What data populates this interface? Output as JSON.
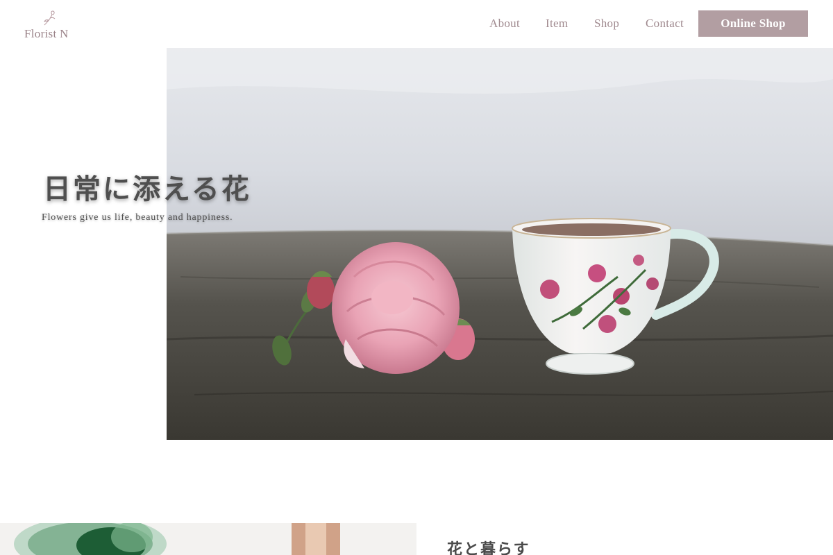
{
  "header": {
    "logo_text": "Florist N",
    "logo_icon": "flower-sprig-icon",
    "nav": {
      "about": "About",
      "item": "Item",
      "shop": "Shop",
      "contact": "Contact"
    },
    "online_shop_label": "Online Shop"
  },
  "hero": {
    "title": "日常に添える花",
    "subtitle": "Flowers give us life, beauty and happiness.",
    "image": "pink-rose-and-teacup-photo"
  },
  "section": {
    "title": "花と暮らす",
    "image": "green-glass-vases-photo"
  },
  "colors": {
    "accent": "#b29ea2",
    "nav_text": "#a08a8f",
    "logo_text": "#9a8288",
    "heading_text": "#4f4f4f"
  }
}
